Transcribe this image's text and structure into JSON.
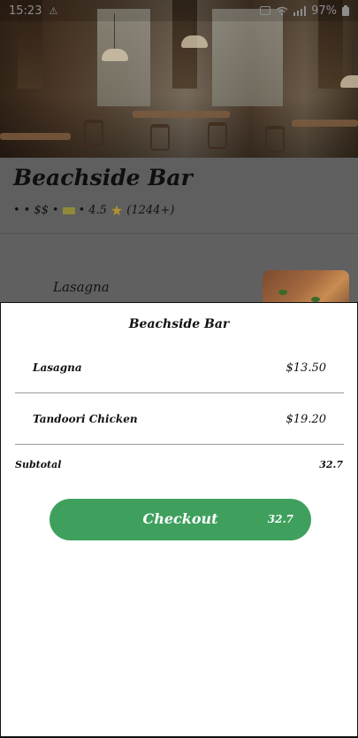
{
  "status_bar": {
    "time": "15:23",
    "alert_glyph": "⚠",
    "battery_text": "97%",
    "icons": [
      "shield-icon",
      "wifi-icon",
      "signal-icon",
      "battery-icon"
    ]
  },
  "restaurant": {
    "name": "Beachside Bar",
    "meta": {
      "dot1": "•",
      "dot2": "•",
      "price_level": "$$",
      "dot3": "•",
      "dot4": "•",
      "rating": "4.5",
      "review_count": "(1244+)"
    }
  },
  "menu": {
    "items": [
      {
        "name": "Lasagna"
      }
    ]
  },
  "cart": {
    "title": "Beachside Bar",
    "items": [
      {
        "name": "Lasagna",
        "price": "$13.50"
      },
      {
        "name": "Tandoori Chicken",
        "price": "$19.20"
      }
    ],
    "subtotal_label": "Subtotal",
    "subtotal_value": "32.7",
    "checkout_label": "Checkout",
    "checkout_amount": "32.7"
  },
  "colors": {
    "accent": "#3fa05e",
    "overlay": "#606060",
    "sheet": "#ffffff"
  }
}
